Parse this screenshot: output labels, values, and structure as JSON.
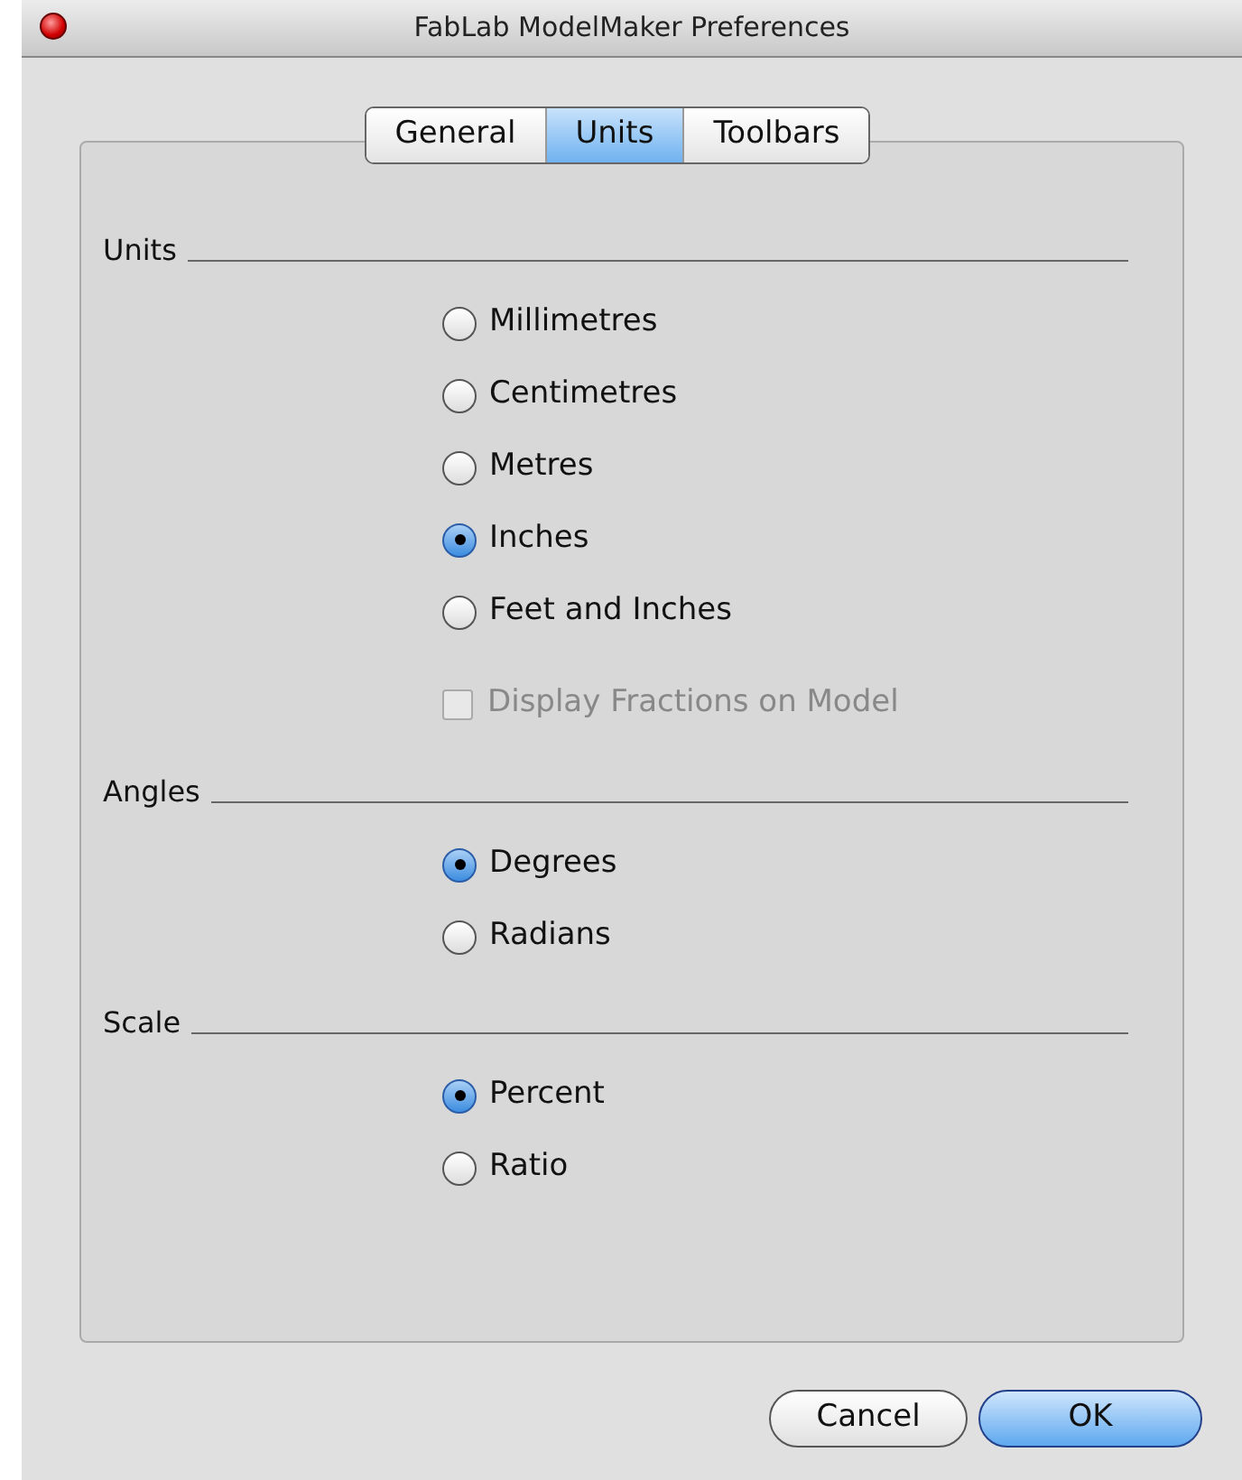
{
  "window": {
    "title": "FabLab ModelMaker Preferences"
  },
  "tabs": [
    {
      "label": "General",
      "selected": false
    },
    {
      "label": "Units",
      "selected": true
    },
    {
      "label": "Toolbars",
      "selected": false
    }
  ],
  "sections": [
    {
      "title": "Units",
      "options": [
        {
          "kind": "radio",
          "label": "Millimetres",
          "selected": false
        },
        {
          "kind": "radio",
          "label": "Centimetres",
          "selected": false
        },
        {
          "kind": "radio",
          "label": "Metres",
          "selected": false
        },
        {
          "kind": "radio",
          "label": "Inches",
          "selected": true
        },
        {
          "kind": "radio",
          "label": "Feet and Inches",
          "selected": false
        },
        {
          "kind": "checkbox",
          "label": "Display Fractions on Model",
          "checked": false,
          "disabled": true
        }
      ]
    },
    {
      "title": "Angles",
      "options": [
        {
          "kind": "radio",
          "label": "Degrees",
          "selected": true
        },
        {
          "kind": "radio",
          "label": "Radians",
          "selected": false
        }
      ]
    },
    {
      "title": "Scale",
      "options": [
        {
          "kind": "radio",
          "label": "Percent",
          "selected": true
        },
        {
          "kind": "radio",
          "label": "Ratio",
          "selected": false
        }
      ]
    }
  ],
  "buttons": [
    {
      "label": "Cancel",
      "kind": "normal"
    },
    {
      "label": "OK",
      "kind": "default"
    }
  ]
}
